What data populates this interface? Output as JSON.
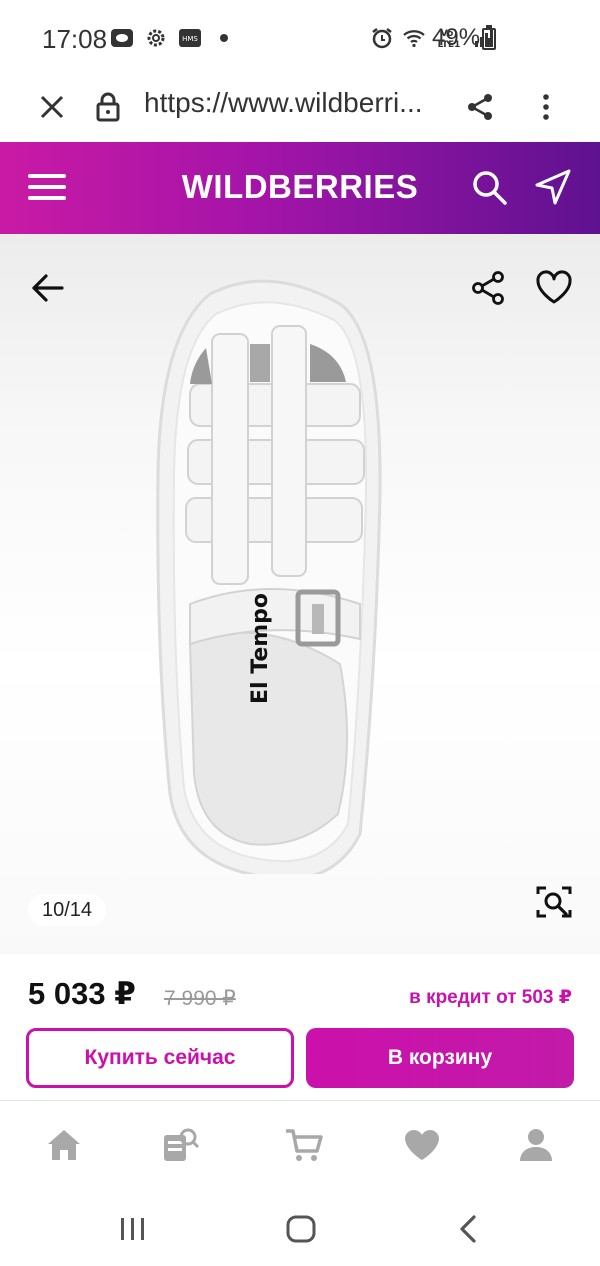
{
  "status_bar": {
    "time": "17:08",
    "battery_percent": "49%",
    "battery_level": 0.49,
    "network_label": "LTE1",
    "left_icons": [
      "screen-record-icon",
      "settings-gear-icon",
      "hms-icon",
      "dot-icon"
    ],
    "right_icons": [
      "alarm-icon",
      "wifi-icon",
      "signal-icon"
    ],
    "hms_label": "HMS",
    "volte_label": "Vo)"
  },
  "browser": {
    "url": "https://www.wildberri...",
    "icons": [
      "close-icon",
      "lock-icon",
      "share-icon",
      "more-vertical-icon"
    ]
  },
  "header": {
    "logo": "WILDBERRIES",
    "icons": [
      "menu-icon",
      "search-icon",
      "location-arrow-icon"
    ]
  },
  "gallery": {
    "counter": "10/14",
    "insole_brand": "El Tempo",
    "icons": [
      "back-arrow-icon",
      "share-icon",
      "heart-icon",
      "visual-search-icon"
    ]
  },
  "price": {
    "current": "5 033 ₽",
    "old": "7 990 ₽",
    "credit": "в кредит от 503 ₽"
  },
  "buttons": {
    "buy_now": "Купить сейчас",
    "add_to_cart": "В корзину"
  },
  "bottom_nav": {
    "items": [
      "home-icon",
      "catalog-icon",
      "cart-icon",
      "favorites-icon",
      "profile-icon"
    ]
  },
  "system_nav": {
    "items": [
      "recent-apps-icon",
      "home-button-icon",
      "back-icon"
    ]
  },
  "colors": {
    "brand": "#cb11ab",
    "header_gradient_start": "#c91aa5",
    "header_gradient_end": "#5e1290",
    "nav_icon": "#a8a8a8"
  }
}
